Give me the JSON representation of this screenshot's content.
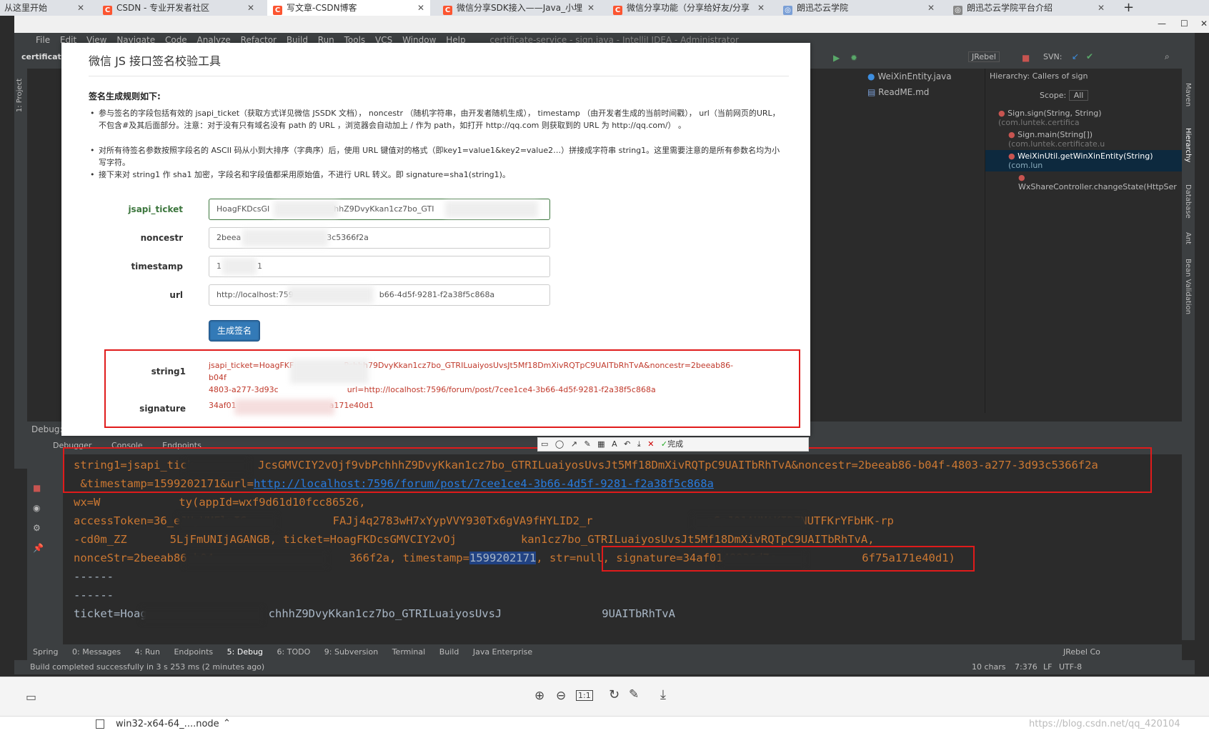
{
  "browser_tabs": [
    {
      "title": "从这里开始",
      "icon": "folder-icon"
    },
    {
      "title": "CSDN - 专业开发者社区",
      "icon": "csdn-icon"
    },
    {
      "title": "写文章-CSDN博客",
      "icon": "csdn-icon",
      "active": true
    },
    {
      "title": "微信分享SDK接入——Java_小埋",
      "icon": "csdn-icon"
    },
    {
      "title": "微信分享功能（分享给好友/分享",
      "icon": "csdn-icon"
    },
    {
      "title": "朗迅芯云学院",
      "icon": "globe-icon"
    },
    {
      "title": "朗迅芯云学院平台介绍",
      "icon": "globe-icon"
    }
  ],
  "new_tab": "+",
  "ide": {
    "menu": [
      "File",
      "Edit",
      "View",
      "Navigate",
      "Code",
      "Analyze",
      "Refactor",
      "Build",
      "Run",
      "Tools",
      "VCS",
      "Window",
      "Help"
    ],
    "window_title": "certificate-service - sign.java - IntelliJ IDEA - Administrator",
    "project_label": "certificate_s",
    "project_tab": "1: Project",
    "toolbar": {
      "jrebel": "JRebel",
      "svn": "SVN:"
    },
    "editor_tabs": [
      "WeiXinEntity.java",
      "ReadME.md"
    ],
    "hierarchy": {
      "title": "Hierarchy:  Callers of sign",
      "scope_label": "Scope:",
      "scope_value": "All",
      "items": [
        {
          "text": "Sign.sign(String, String)",
          "pkg": "(com.luntek.certifica"
        },
        {
          "text": "Sign.main(String[])",
          "pkg": "(com.luntek.certificate.u"
        },
        {
          "text": "WeiXinUtil.getWinXinEntity(String)",
          "pkg": "(com.lun"
        },
        {
          "text": "WxShareController.changeState(HttpSer",
          "pkg": ""
        }
      ]
    },
    "right_tools": [
      "Maven",
      "Hierarchy",
      "Database",
      "Ant",
      "Bean Validation"
    ],
    "debug": {
      "label": "Debug:",
      "tabs": [
        "Debugger",
        "Console",
        "Endpoints"
      ],
      "console_lines": [
        {
          "text": "string1=jsapi_tick",
          "tail": "JcsGMVCIY2vOjf9vbPchhhZ9DvyKkan1cz7bo_GTRILuaiyosUvsJt5Mf18DmXivRQTpC9UAITbRhTvA&noncestr=2beeab86-b04f-4803-a277-3d93c5366f2a"
        },
        {
          "text": " &timestamp=1599202171&url=",
          "link": "http://localhost:7596/forum/post/7cee1ce4-3b66-4d5f-9281-f2a38f5c868a"
        },
        {
          "text": "wx=W",
          "tail": "ty(appId=wxf9d61d10fcc86526,"
        },
        {
          "text": "accessToken=36_eJUyVMFlnIS",
          "tail": "FAJj4q2783wH7xYypVVY930Tx6gVA9fHYLID2_r",
          "tail2": "pSpJ01AUMtKIDZNUTFKrYFbHK-rp"
        },
        {
          "text": "-cd0m_ZZ",
          "tail": "5LjFmUNIjAGANGB, ticket=HoagFKDcsGMVCIY2vOj",
          "tail2": "kan1cz7bo_GTRILuaiyosUvsJt5Mf18DmXivRQTpC9UAITbRhTvA,"
        },
        {
          "text": "nonceStr=2beeab86-b04",
          "tail": "366f2a, timestamp=",
          "ts": "1599202171",
          "tail2": ", str=null, signature=34af0148936d7c",
          "tail3": "6f75a171e40d1)"
        },
        {
          "text": "------"
        },
        {
          "text": "------"
        },
        {
          "text": "ticket=Hoag",
          "tail": "chhhZ9DvyKkan1cz7bo_GTRILuaiyosUvsJ",
          "tail2": "9UAITbRhTvA"
        }
      ]
    },
    "bottom_tabs": [
      "Spring",
      "0: Messages",
      "4: Run",
      "Endpoints",
      "5: Debug",
      "6: TODO",
      "9: Subversion",
      "Terminal",
      "Build",
      "Java Enterprise",
      "JRebel Co"
    ],
    "status": {
      "message": "Build completed successfully in 3 s 253 ms (2 minutes ago)",
      "chars": "10 chars",
      "position": "7:376",
      "lf": "LF",
      "encoding": "UTF-8"
    }
  },
  "tool": {
    "title": "微信 JS 接口签名校验工具",
    "rules_heading": "签名生成规则如下:",
    "rules": [
      "参与签名的字段包括有效的 jsapi_ticket（获取方式详见微信 JSSDK 文档）， noncestr （随机字符串，由开发者随机生成）， timestamp （由开发者生成的当前时间戳）， url（当前网页的URL，不包含#及其后面部分。注意：对于没有只有域名没有 path 的 URL ，浏览器会自动加上 / 作为 path，如打开 http://qq.com 则获取到的 URL 为 http://qq.com/） 。",
      "对所有待签名参数按照字段名的 ASCII 码从小到大排序（字典序）后，使用 URL 键值对的格式（即key1=value1&key2=value2…）拼接成字符串 string1。这里需要注意的是所有参数名均为小写字符。",
      "接下来对 string1 作 sha1 加密，字段名和字段值都采用原始值，不进行 URL 转义。即 signature=sha1(string1)。"
    ],
    "fields": [
      {
        "label": "jsapi_ticket",
        "value": "HoagFKDcsGI",
        "tail": "hhZ9DvyKkan1cz7bo_GTI"
      },
      {
        "label": "noncestr",
        "value": "2beea",
        "tail": "3c5366f2a"
      },
      {
        "label": "timestamp",
        "value": "1",
        "tail": "1"
      },
      {
        "label": "url",
        "value": "http://localhost:759",
        "tail": "b66-4d5f-9281-f2a38f5c868a"
      }
    ],
    "button": "生成签名",
    "results": [
      {
        "label": "string1",
        "line1": "jsapi_ticket=HoagFKF",
        "line1b": "Pchhh79DvyKkan1cz7bo_GTRILuaiyosUvsJt5Mf18DmXivRQTpC9UAITbRhTvA&noncestr=2beeab86-b04f",
        "line2": "4803-a277-3d93c",
        "line2b": "url=http://localhost:7596/forum/post/7cee1ce4-3b66-4d5f-9281-f2a38f5c868a"
      },
      {
        "label": "signature",
        "value": "34af01",
        "tail": "a171e40d1"
      }
    ],
    "annotate_done": "完成"
  },
  "viewer": {
    "zoom_in": "zoom-in-icon",
    "zoom_out": "zoom-out-icon",
    "fit": "1:1",
    "rotate": "rotate-icon",
    "edit": "edit-icon",
    "download": "download-icon"
  },
  "download_bar": {
    "file": "win32-x64-64_....node"
  },
  "watermark": "https://blog.csdn.net/qq_420104"
}
